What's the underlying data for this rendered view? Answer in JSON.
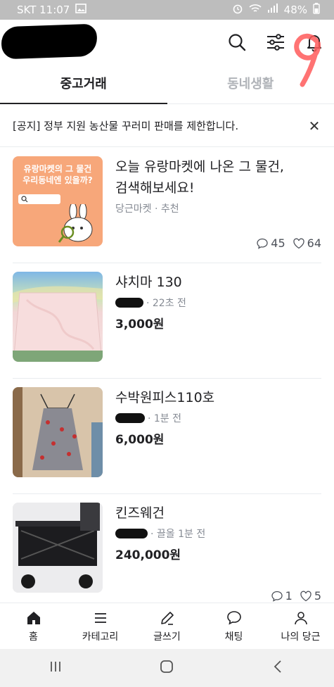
{
  "status_bar": {
    "carrier_time": "SKT 11:07",
    "battery": "48%"
  },
  "header": {
    "icons": [
      "search-icon",
      "filter-icon",
      "bell-icon"
    ]
  },
  "tabs": [
    {
      "label": "중고거래",
      "active": true
    },
    {
      "label": "동네생활",
      "active": false
    }
  ],
  "notice": {
    "text": "[공지] 정부 지원 농산물 꾸러미 판매를 제한합니다."
  },
  "items": [
    {
      "title_line1": "오늘 유랑마켓에 나온 그 물건,",
      "title_line2": "검색해보세요!",
      "meta": "당근마켓 · 추천",
      "thumb_text1": "유랑마켓의 그 물건",
      "thumb_text2": "우리동네엔 있을까?",
      "comments": "45",
      "likes": "64"
    },
    {
      "title": "샤치마 130",
      "meta_time": "· 22초 전",
      "price": "3,000원"
    },
    {
      "title": "수박원피스110호",
      "meta_time": "· 1분 전",
      "price": "6,000원"
    },
    {
      "title": "킨즈웨건",
      "meta_time": "· 끌올 1분 전",
      "price": "240,000원",
      "comments": "1",
      "likes": "5"
    }
  ],
  "bottom_nav": [
    {
      "label": "홈",
      "icon": "home-icon"
    },
    {
      "label": "카테고리",
      "icon": "menu-icon"
    },
    {
      "label": "글쓰기",
      "icon": "pencil-icon"
    },
    {
      "label": "채팅",
      "icon": "chat-icon"
    },
    {
      "label": "나의 당근",
      "icon": "user-icon"
    }
  ],
  "colors": {
    "status_bar": "#bdbdbd",
    "thumb_promo_bg": "#f7a77a",
    "scribble": "#ff4d4d"
  }
}
